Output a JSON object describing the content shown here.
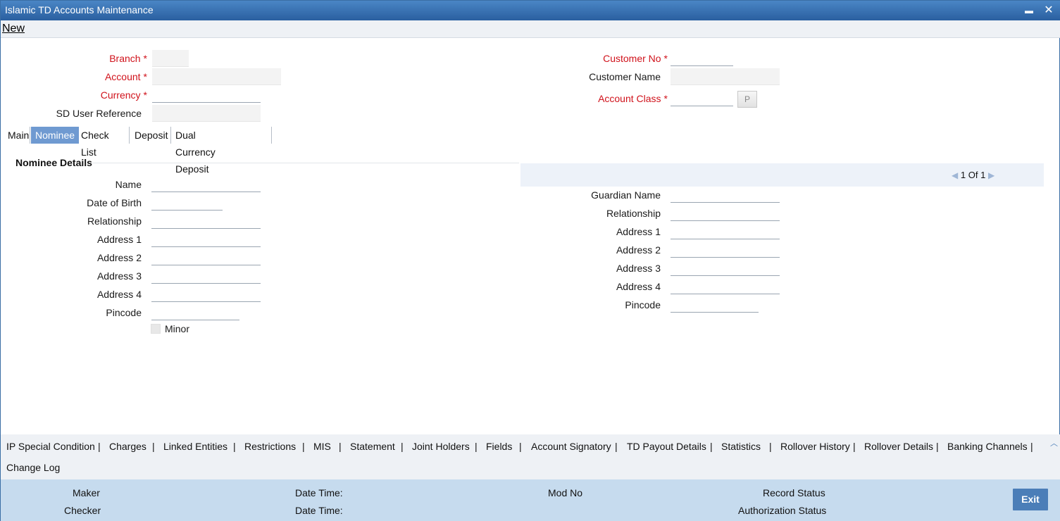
{
  "window": {
    "title": "Islamic TD Accounts Maintenance",
    "minimize_glyph": "▬",
    "close_glyph": "✕"
  },
  "menu": {
    "new_label": "New"
  },
  "header": {
    "branch_label": "Branch",
    "account_label": "Account",
    "currency_label": "Currency",
    "sd_user_ref_label": "SD User Reference",
    "customer_no_label": "Customer No",
    "customer_name_label": "Customer Name",
    "account_class_label": "Account Class",
    "account_class_button": "P",
    "required_mark": "*"
  },
  "tabs": [
    {
      "label": "Main",
      "active": false
    },
    {
      "label": "Nominee",
      "active": true
    },
    {
      "label": "Check List",
      "active": false
    },
    {
      "label": "Deposit",
      "active": false
    },
    {
      "label": "Dual Currency Deposit",
      "active": false
    }
  ],
  "nominee": {
    "section_title": "Nominee Details",
    "pager": {
      "current": "1",
      "of_label": "Of",
      "total": "1"
    },
    "left_labels": {
      "name": "Name",
      "dob": "Date of Birth",
      "relationship": "Relationship",
      "address1": "Address 1",
      "address2": "Address 2",
      "address3": "Address 3",
      "address4": "Address 4",
      "pincode": "Pincode",
      "minor": "Minor"
    },
    "right_labels": {
      "guardian_name": "Guardian Name",
      "relationship": "Relationship",
      "address1": "Address 1",
      "address2": "Address 2",
      "address3": "Address 3",
      "address4": "Address 4",
      "pincode": "Pincode"
    }
  },
  "subscreens": [
    "IP Special Condition",
    "Charges",
    "Linked Entities",
    "Restrictions",
    "MIS",
    "Statement",
    "Joint Holders",
    "Fields",
    "Account Signatory",
    "TD Payout Details",
    "Statistics",
    "Rollover History",
    "Rollover Details",
    "Banking Channels",
    "Change Log"
  ],
  "subscreen_separator": "|",
  "footer": {
    "maker": "Maker",
    "checker": "Checker",
    "date_time": "Date Time:",
    "mod_no": "Mod No",
    "record_status": "Record Status",
    "authorization_status": "Authorization Status",
    "exit_label": "Exit"
  }
}
